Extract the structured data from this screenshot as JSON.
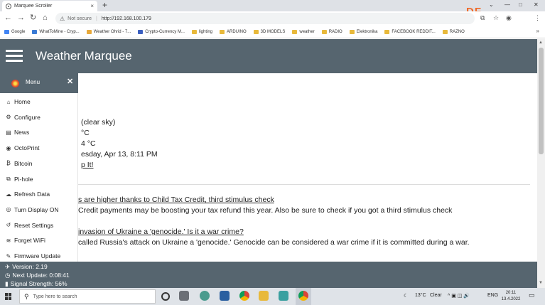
{
  "browser": {
    "tab_title": "Marquee Scroller",
    "tab_close": "×",
    "new_tab": "+",
    "window_controls": [
      "⌄",
      "—",
      "□",
      "✕"
    ],
    "nav": {
      "back": "←",
      "forward": "→",
      "reload": "↻",
      "home": "⌂"
    },
    "security_label": "Not secure",
    "separator": "|",
    "url": "http://192.168.100.179",
    "bookmarks": [
      {
        "label": "Google",
        "color": "#4285f4"
      },
      {
        "label": "WhatToMine - Cryp...",
        "color": "#3a7bd5"
      },
      {
        "label": "Weather Ohrid - 7...",
        "color": "#e8a93b"
      },
      {
        "label": "Crypto-Currency M...",
        "color": "#3b5fc0"
      },
      {
        "label": "lighting",
        "color": "#e8b93b"
      },
      {
        "label": "ARDUINO",
        "color": "#e8b93b"
      },
      {
        "label": "3D MODELS",
        "color": "#e8b93b"
      },
      {
        "label": "weather",
        "color": "#e8b93b"
      },
      {
        "label": "RADIO",
        "color": "#e8b93b"
      },
      {
        "label": "Elektronika",
        "color": "#e8b93b"
      },
      {
        "label": "FACEBOOK REDDIT...",
        "color": "#e8b93b"
      },
      {
        "label": "RAZNO",
        "color": "#e8b93b"
      }
    ],
    "bookmarks_more": "»",
    "watermark": "DF"
  },
  "page": {
    "title": "Weather Marquee",
    "weather_lines": [
      "(clear sky)",
      "°C",
      "4 °C",
      "esday, Apr 13, 8:11 PM"
    ],
    "weather_link": "p It!",
    "news": [
      {
        "headline": "s are higher thanks to Child Tax Credit, third stimulus check",
        "summary": "Credit payments may be boosting your tax refund this year. Also be sure to check if you got a third stimulus check"
      },
      {
        "headline": "invasion of Ukraine a 'genocide.' Is it a war crime?",
        "summary": "called Russia's attack on Ukraine a 'genocide.' Genocide can be considered a war crime if it is committed during a war."
      }
    ]
  },
  "menu": {
    "label": "Menu",
    "close": "✕",
    "items": [
      {
        "label": "Home",
        "icon": "⌂"
      },
      {
        "label": "Configure",
        "icon": "⚙"
      },
      {
        "label": "News",
        "icon": "▤"
      },
      {
        "label": "OctoPrint",
        "icon": "◉"
      },
      {
        "label": "Bitcoin",
        "icon": "₿"
      },
      {
        "label": "Pi-hole",
        "icon": "⧉"
      },
      {
        "label": "Refresh Data",
        "icon": "☁"
      },
      {
        "label": "Turn Display ON",
        "icon": "◎"
      },
      {
        "label": "Reset Settings",
        "icon": "↺"
      },
      {
        "label": "Forget WiFi",
        "icon": "≋"
      },
      {
        "label": "Firmware Update",
        "icon": "✎"
      }
    ]
  },
  "footer": {
    "version": "Version: 2.19",
    "next_update": "Next Update: 0:08:41",
    "signal": "Signal Strength: 56%",
    "icons": [
      "✈",
      "◷",
      "▮"
    ]
  },
  "taskbar": {
    "search_placeholder": "Type here to search",
    "weather_temp": "13°C",
    "weather_desc": "Clear",
    "tray_icons": "^  ▣  ◫  🔊",
    "language": "ENG",
    "time": "20:11",
    "date": "13.4.2022",
    "notification": "▭"
  }
}
